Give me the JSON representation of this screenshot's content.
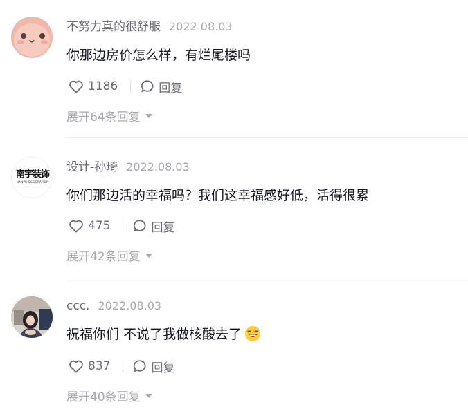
{
  "comments": [
    {
      "username": "不努力真的很舒服",
      "date": "2022.08.03",
      "text": "你那边房价怎么样，有烂尾楼吗",
      "likes": "1186",
      "reply_label": "回复",
      "expand_label": "展开64条回复"
    },
    {
      "username": "设计-孙琦",
      "date": "2022.08.03",
      "text": "你们那边活的幸福吗？我们这幸福感好低，活得很累",
      "likes": "475",
      "reply_label": "回复",
      "expand_label": "展开42条回复",
      "avatar_logo_top": "南宇装饰",
      "avatar_logo_bottom": "NANYU DECORATION"
    },
    {
      "username": "ccc.",
      "date": "2022.08.03",
      "text": "祝福你们 不说了我做核酸去了",
      "likes": "837",
      "reply_label": "回复",
      "expand_label": "展开40条回复"
    }
  ],
  "icons": {
    "like": "heart-outline-icon",
    "reply": "speech-bubble-icon",
    "expand": "caret-down-icon",
    "emoji": "sweat-smile-emoji"
  },
  "colors": {
    "text": "#161823",
    "secondary": "#6b6e76",
    "muted": "#a7a9ae",
    "divider": "#eeeeef"
  }
}
